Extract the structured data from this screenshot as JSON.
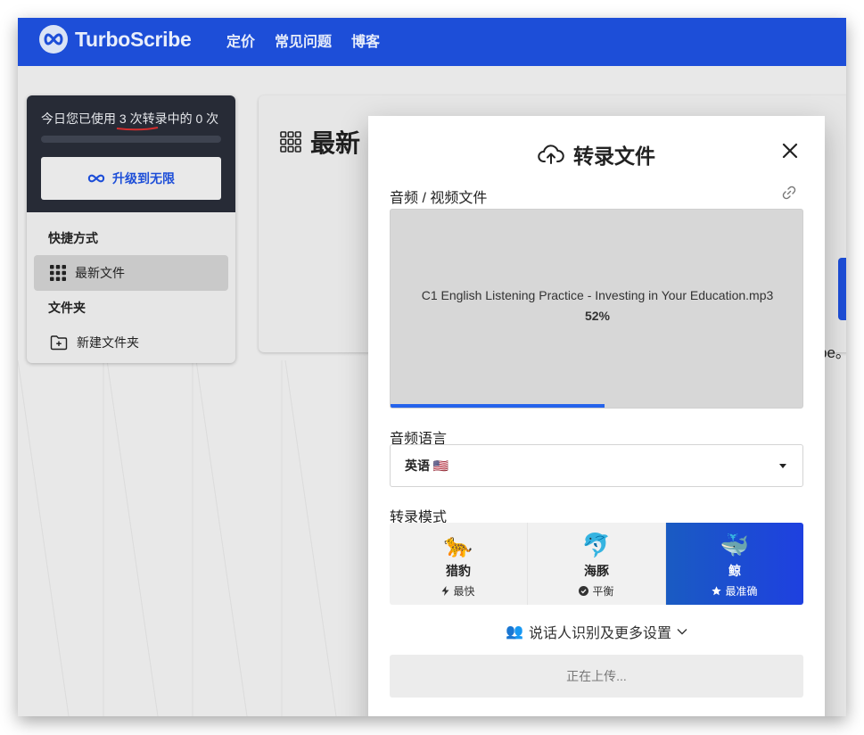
{
  "topbar": {
    "brand": "TurboScribe",
    "nav": [
      "定价",
      "常见问题",
      "博客"
    ],
    "brand_color": "#1d4ed8"
  },
  "sidebar": {
    "usage_text": "今日您已使用 3 次转录中的 0 次",
    "upgrade_label": "升级到无限",
    "shortcuts_heading": "快捷方式",
    "recent_files": "最新文件",
    "folders_heading": "文件夹",
    "new_folder": "新建文件夹"
  },
  "background": {
    "title_fragment": "最新",
    "tail_text": "be。"
  },
  "modal": {
    "title": "转录文件",
    "file_label": "音频 / 视频文件",
    "file_name": "C1 English Listening Practice - Investing in Your Education.mp3",
    "progress_text": "52%",
    "progress_fraction": 0.52,
    "language_label": "音频语言",
    "language_value": "英语 🇺🇸",
    "mode_label": "转录模式",
    "modes": [
      {
        "emoji": "🐆",
        "name": "猎豹",
        "sub": "最快",
        "icon": "bolt-icon",
        "selected": false
      },
      {
        "emoji": "🐬",
        "name": "海豚",
        "sub": "平衡",
        "icon": "check-circle-icon",
        "selected": false
      },
      {
        "emoji": "🐳",
        "name": "鲸",
        "sub": "最准确",
        "icon": "star-icon",
        "selected": true
      }
    ],
    "more_settings": "说话人识别及更多设置",
    "more_icon": "👥",
    "upload_status": "正在上传..."
  }
}
